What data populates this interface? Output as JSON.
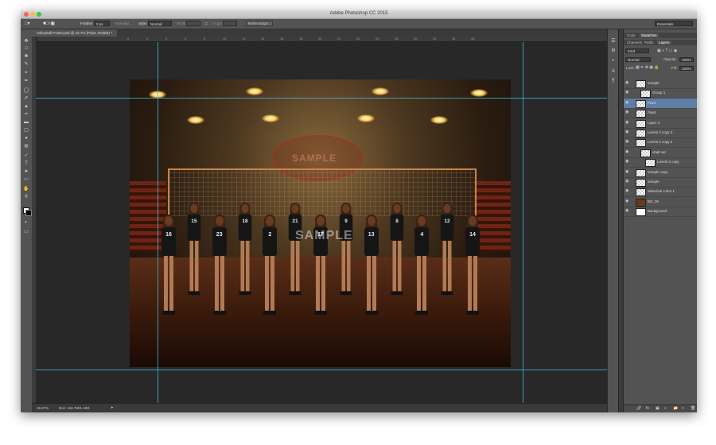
{
  "window": {
    "title": "Adobe Photoshop CC 2015",
    "traffic_lights": [
      "#fc605c",
      "#fdbc40",
      "#34c84a"
    ]
  },
  "options_bar": {
    "feather_label": "Feather:",
    "feather_value": "0 px",
    "anti_alias_label": "Anti-alias",
    "style_label": "Style:",
    "style_value": "Normal",
    "width_label": "Width:",
    "height_label": "Height:",
    "refine_edge_label": "Refine Edge...",
    "workspace": "Essentials"
  },
  "document": {
    "tab_label": "Volleyball Poster.psd @ 16.7% (Paint, RGB/8) *",
    "ruler_ticks": [
      "0",
      "2",
      "4",
      "6",
      "8",
      "10",
      "12",
      "14",
      "16",
      "18",
      "20",
      "22",
      "24",
      "26",
      "28",
      "30",
      "32",
      "34",
      "36"
    ],
    "watermark_main": "SAMPLE",
    "watermark_logo": "SAMPLE",
    "jerseys": [
      "16",
      "15",
      "23",
      "18",
      "2",
      "21",
      "17",
      "9",
      "13",
      "8",
      "4",
      "12",
      "14"
    ],
    "guide_color": "#3fb6d6"
  },
  "status_bar": {
    "zoom": "16.67%",
    "doc_size": "Doc: 116.7M/1.19G"
  },
  "tools": [
    "move-tool",
    "marquee-tool",
    "lasso-tool",
    "quick-select-tool",
    "crop-tool",
    "eyedropper-tool",
    "healing-tool",
    "brush-tool",
    "clone-stamp-tool",
    "history-brush-tool",
    "eraser-tool",
    "gradient-tool",
    "blur-tool",
    "dodge-tool",
    "pen-tool",
    "type-tool",
    "path-select-tool",
    "rectangle-tool",
    "hand-tool",
    "zoom-tool"
  ],
  "panel": {
    "top_tabs": [
      "Color",
      "Swatches"
    ],
    "sub_tabs": [
      "Channels",
      "Paths",
      "Layers"
    ],
    "kind_label": "Kind",
    "blend_mode": "Normal",
    "opacity_label": "Opacity:",
    "opacity_value": "100%",
    "lock_label": "Lock:",
    "fill_label": "Fill:",
    "fill_value": "100%",
    "selected_layer_color": "#5f7ea6",
    "layers": [
      {
        "name": "sample",
        "indent": 0,
        "selected": false
      },
      {
        "name": "Group 1",
        "indent": 1,
        "selected": false
      },
      {
        "name": "Paint",
        "indent": 0,
        "selected": true
      },
      {
        "name": "Paint",
        "indent": 0,
        "selected": false
      },
      {
        "name": "Layer 4",
        "indent": 0,
        "selected": false
      },
      {
        "name": "Levels 2 copy 3",
        "indent": 0,
        "selected": false
      },
      {
        "name": "Levels 2 copy 2",
        "indent": 0,
        "selected": false
      },
      {
        "name": "vball net",
        "indent": 1,
        "selected": false
      },
      {
        "name": "Levels 3 copy",
        "indent": 2,
        "selected": false
      },
      {
        "name": "sample copy",
        "indent": 0,
        "selected": false
      },
      {
        "name": "sample",
        "indent": 0,
        "selected": false
      },
      {
        "name": "Selective Color 1",
        "indent": 0,
        "selected": false
      },
      {
        "name": "BG_06",
        "indent": 0,
        "selected": false
      },
      {
        "name": "Background",
        "indent": 0,
        "selected": false
      }
    ]
  }
}
